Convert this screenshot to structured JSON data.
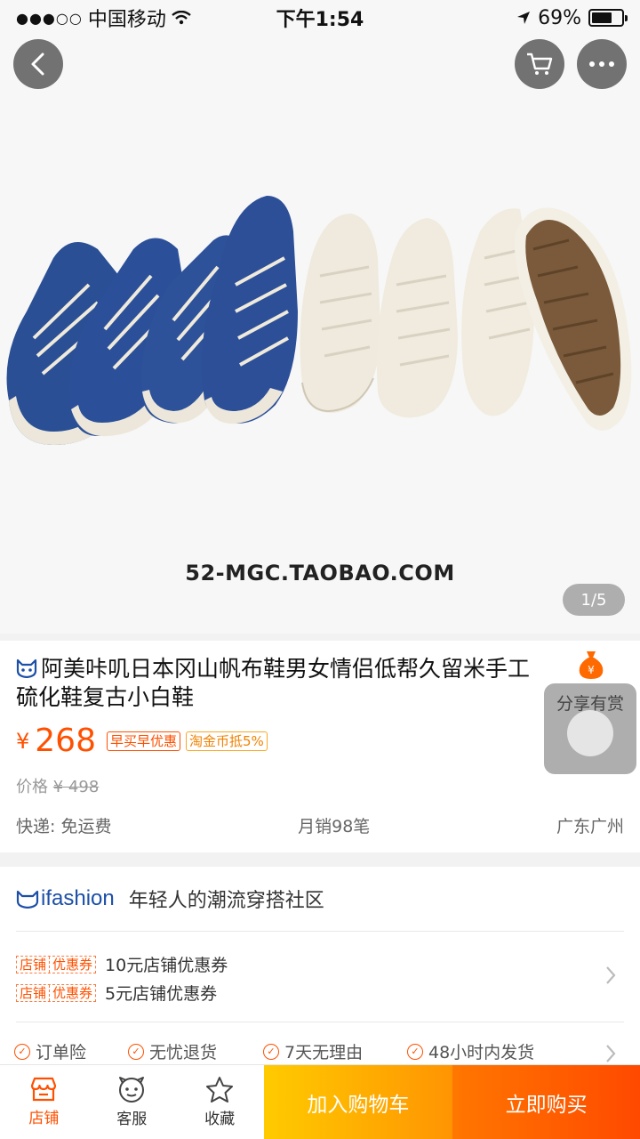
{
  "status_bar": {
    "carrier": "中国移动",
    "time": "下午1:54",
    "battery": "69%",
    "battery_level": 0.69
  },
  "hero": {
    "watermark": "52-MGC.TAOBAO.COM",
    "page_indicator": "1/5",
    "current_page": 1,
    "total_pages": 5
  },
  "product": {
    "title": "阿美咔叽日本冈山帆布鞋男女情侣低帮久留米手工硫化鞋复古小白鞋",
    "price_symbol": "¥",
    "price": "268",
    "tags": [
      "早买早优惠",
      "淘金币抵5%"
    ],
    "original_price_label": "价格",
    "original_price": "¥ 498",
    "shipping": "快递: 免运费",
    "monthly_sales": "月销98笔",
    "location": "广东广州"
  },
  "share": {
    "label": "分享有赏"
  },
  "shop": {
    "brand": "ifashion",
    "slogan": "年轻人的潮流穿搭社区",
    "coupons": [
      {
        "tag_left": "店铺",
        "tag_right": "优惠券",
        "text": "10元店铺优惠券"
      },
      {
        "tag_left": "店铺",
        "tag_right": "优惠券",
        "text": "5元店铺优惠券"
      }
    ],
    "services": [
      "订单险",
      "无忧退货",
      "7天无理由",
      "48小时内发货"
    ]
  },
  "bottom_bar": {
    "store": "店铺",
    "service": "客服",
    "favorite": "收藏",
    "add_to_cart": "加入购物车",
    "buy_now": "立即购买"
  },
  "colors": {
    "accent": "#ff5000",
    "cart_button": "#ffb300",
    "buy_button": "#ff5a00",
    "brand_blue": "#1c4fa8"
  }
}
